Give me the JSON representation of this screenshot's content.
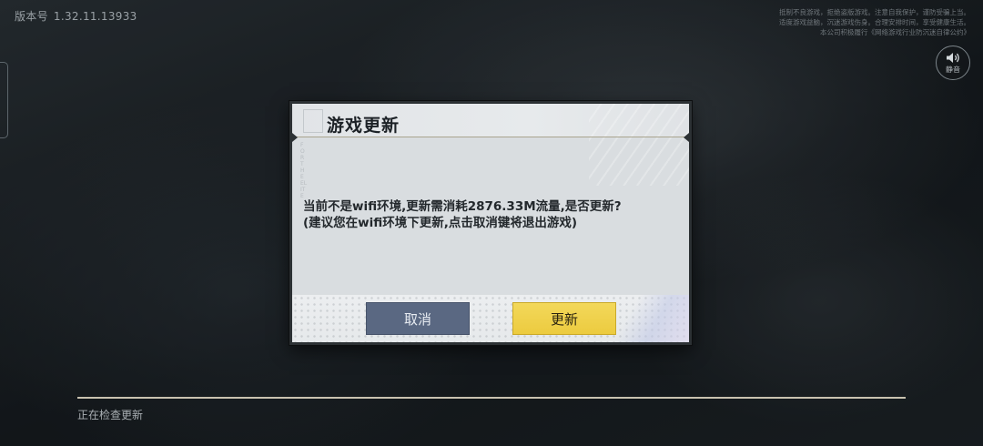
{
  "version": {
    "label": "版本号",
    "number": "1.32.11.13933"
  },
  "notice_lines": [
    "抵制不良游戏，拒绝盗版游戏。注意自我保护，谨防受骗上当。",
    "适度游戏益脑，沉迷游戏伤身。合理安排时间，享受健康生活。",
    "本公司积极履行《网络游戏行业防沉迷自律公约》"
  ],
  "mute": {
    "icon": "speaker-icon",
    "label": "静音"
  },
  "dialog": {
    "title": "游戏更新",
    "decoration_text": "FOR THE ELITE",
    "message_line1": "当前不是wifi环境,更新需消耗2876.33M流量,是否更新?",
    "message_line2": "(建议您在wifi环境下更新,点击取消键将退出游戏)",
    "cancel_label": "取消",
    "confirm_label": "更新"
  },
  "status": {
    "text": "正在检查更新",
    "progress": 1.0
  },
  "colors": {
    "cancel_button": "#5a6882",
    "update_button": "#eccb3f",
    "dialog_background": "#d9dde0",
    "frame": "#2c3134"
  }
}
